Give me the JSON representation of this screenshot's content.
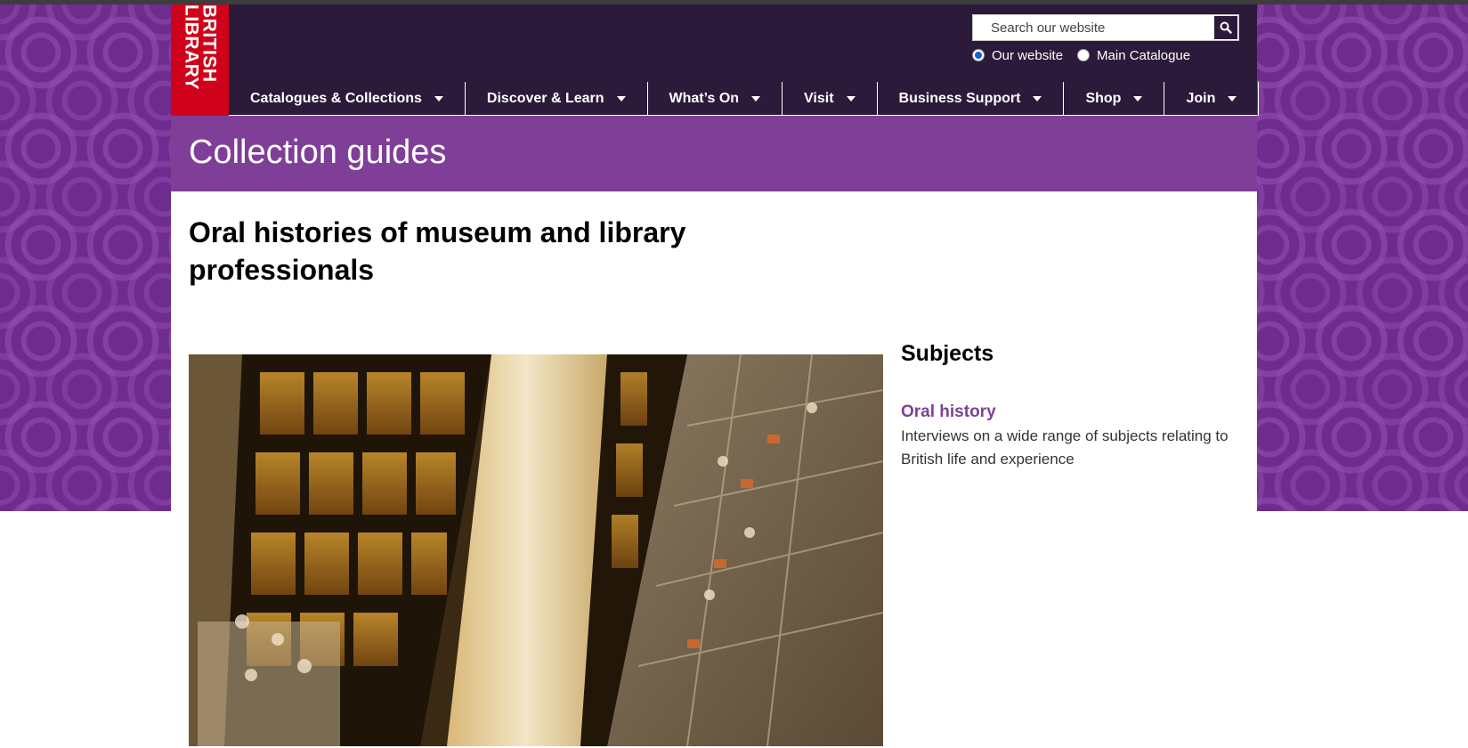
{
  "logo": {
    "text": "BRITISH LIBRARY"
  },
  "search": {
    "placeholder": "Search our website"
  },
  "search_scope": {
    "options": [
      "Our website",
      "Main Catalogue"
    ],
    "selected": "Our website"
  },
  "nav": {
    "items": [
      {
        "label": "Catalogues & Collections"
      },
      {
        "label": "Discover & Learn"
      },
      {
        "label": "What’s On"
      },
      {
        "label": "Visit"
      },
      {
        "label": "Business Support"
      },
      {
        "label": "Shop"
      },
      {
        "label": "Join"
      }
    ]
  },
  "banner": {
    "title": "Collection guides"
  },
  "page": {
    "title": "Oral histories of museum and library professionals"
  },
  "sidebar": {
    "heading": "Subjects",
    "subject": {
      "title": "Oral history",
      "description": "Interviews on a wide range of subjects relating to British life and experience"
    }
  },
  "colors": {
    "header_bg": "#2c1a3a",
    "logo_red": "#d0021b",
    "banner_purple": "#7f3f98",
    "link_purple": "#7f3f98"
  },
  "icons": {
    "search": "magnifier-icon",
    "caret": "caret-down-icon"
  }
}
